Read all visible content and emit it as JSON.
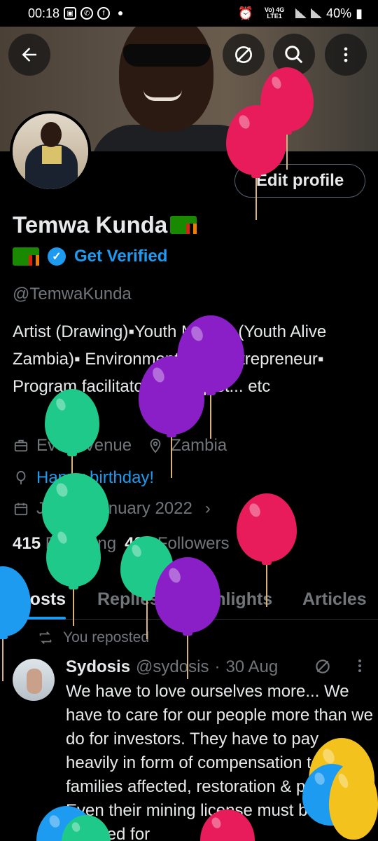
{
  "status_bar": {
    "time": "00:18",
    "network": "Vo) 4G LTE1",
    "battery": "40%"
  },
  "nav": {
    "back_icon": "arrow-left-icon",
    "grok_icon": "slash-circle-icon",
    "search_icon": "search-icon",
    "more_icon": "more-vertical-icon"
  },
  "profile": {
    "edit_label": "Edit profile",
    "name": "Temwa Kunda",
    "verified_label": "Get Verified",
    "handle": "@TemwaKunda",
    "bio": "Artist (Drawing)▪Youth Mentor (Youth Alive Zambia)▪ Environmentalist▪ Entrepreneur▪ Program facilitator▪ Therapist... etc",
    "category": "Event Venue",
    "location": "Zambia",
    "birthday": "Happy birthday!",
    "joined": "Joined January 2022",
    "following_count": "415",
    "following_label": "Following",
    "followers_count": "420",
    "followers_label": "Followers"
  },
  "tabs": [
    {
      "label": "Posts",
      "active": true
    },
    {
      "label": "Replies",
      "active": false
    },
    {
      "label": "Highlights",
      "active": false
    },
    {
      "label": "Articles",
      "active": false
    }
  ],
  "post": {
    "repost_label": "You reposted",
    "author": "Sydosis",
    "handle": "@sydosis",
    "separator": "·",
    "date": "30 Aug",
    "text": "We have to love ourselves more... We have to care for our people more than we do for investors. They have to pay heavily in form of compensation to families affected, restoration & penalties. Even their mining license must be revoked for"
  },
  "colors": {
    "accent": "#1d9bf0",
    "background": "#000000",
    "muted": "#71767b"
  }
}
